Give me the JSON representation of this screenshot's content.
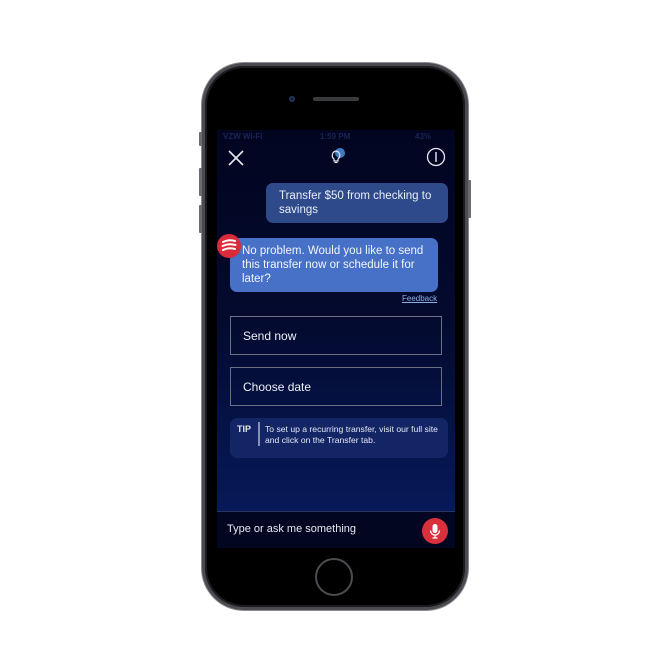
{
  "status_bar": {
    "carrier": "VZW Wi-Fi",
    "time": "1:59 PM",
    "battery": "43%"
  },
  "header": {
    "close_icon": "close-icon",
    "lightbulb_icon": "lightbulb-icon",
    "info_icon": "info-icon"
  },
  "conversation": {
    "user_message": "Transfer $50 from checking to savings",
    "bot_message": "No problem. Would you like to send this transfer now or schedule it for later?",
    "feedback_link": "Feedback"
  },
  "options": [
    {
      "label": "Send now"
    },
    {
      "label": "Choose date"
    }
  ],
  "tip": {
    "label": "TIP",
    "text": "To set up a recurring transfer, visit our full site and click on the Transfer tab."
  },
  "input": {
    "placeholder": "Type or ask me something"
  },
  "colors": {
    "background": "#030a2e",
    "user_bubble": "#2f4a8a",
    "bot_bubble": "#4671c6",
    "accent_red": "#d8303d"
  }
}
